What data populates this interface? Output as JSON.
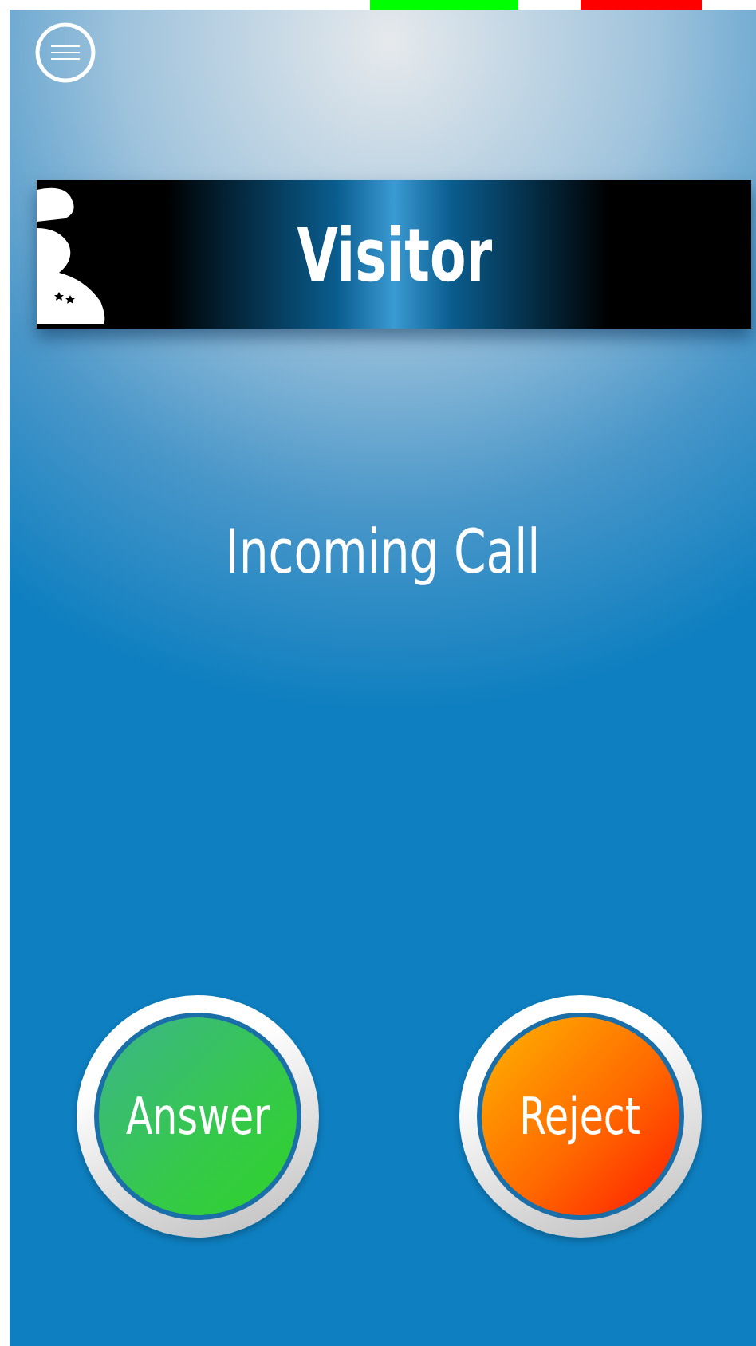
{
  "header": {
    "title": "Visitor"
  },
  "status": "Incoming Call",
  "actions": [
    {
      "label": "Answer",
      "kind": "answer"
    },
    {
      "label": "Reject",
      "kind": "reject"
    }
  ]
}
